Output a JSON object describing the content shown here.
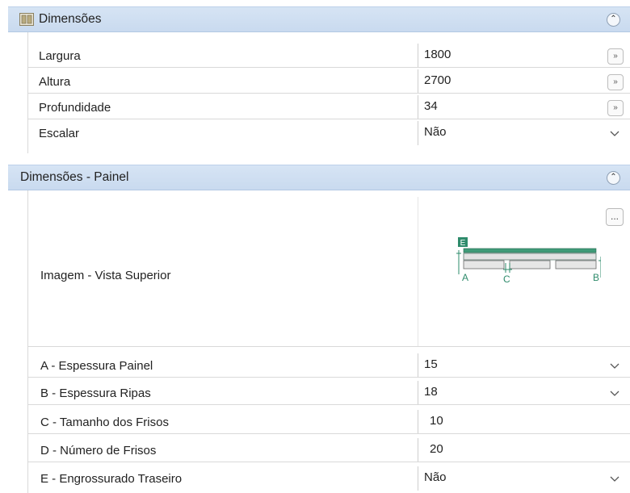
{
  "section1": {
    "title": "Dimensões",
    "rows": [
      {
        "label": "Largura",
        "value": "1800",
        "button": "»"
      },
      {
        "label": "Altura",
        "value": "2700",
        "button": "»"
      },
      {
        "label": "Profundidade",
        "value": "34",
        "button": "»"
      },
      {
        "label": "Escalar",
        "value": "Não"
      }
    ]
  },
  "section2": {
    "title": "Dimensões - Painel",
    "image_row": {
      "label": "Imagem - Vista Superior",
      "button": "...",
      "diagram_labels": {
        "e": "E",
        "a": "A",
        "b": "B",
        "c": "C"
      }
    },
    "rows": [
      {
        "label": "A - Espessura Painel",
        "value": "15"
      },
      {
        "label": "B - Espessura Ripas",
        "value": "18"
      },
      {
        "label": "C - Tamanho dos Frisos",
        "value": "10"
      },
      {
        "label": "D - Número de Frisos",
        "value": "20"
      },
      {
        "label": "E - Engrossurado Traseiro",
        "value": "Não"
      }
    ]
  },
  "colors": {
    "header_bg": "#d0e0f2",
    "diagram_green": "#2e8b6b"
  }
}
